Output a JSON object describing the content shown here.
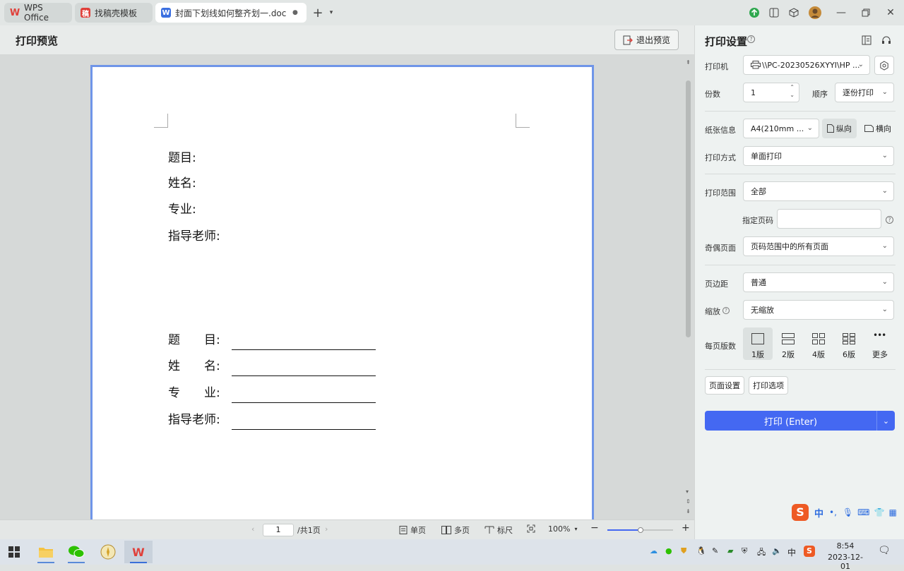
{
  "titlebar": {
    "tabs": [
      {
        "label": "WPS Office",
        "icon": "wps-logo-icon"
      },
      {
        "label": "找稿壳模板",
        "icon": "template-logo-icon"
      },
      {
        "label": "封面下划线如何整齐划一.doc（预",
        "icon": "word-doc-icon"
      }
    ],
    "new_tab": "+",
    "colors": {
      "accent": "#4468f2",
      "wps_red": "#e0403a",
      "word_blue": "#3b6fe0"
    }
  },
  "preview": {
    "title": "打印预览",
    "exit_label": "退出预览"
  },
  "document": {
    "lines_top": [
      "题目:",
      "姓名:",
      "专业:",
      "指导老师:"
    ],
    "lines_bottom": [
      "题　　目:",
      "姓　　名:",
      "专　　业:",
      "指导老师:"
    ]
  },
  "statusbar": {
    "page_value": "1",
    "page_total": "/共1页",
    "single": "单页",
    "multi": "多页",
    "ruler": "标尺",
    "zoom": "100%",
    "zoom_level": 0.5
  },
  "panel": {
    "title": "打印设置",
    "printer_label": "打印机",
    "printer_value": "\\\\PC-20230526XYYI\\HP ...",
    "copies_label": "份数",
    "copies_value": "1",
    "order_label": "顺序",
    "order_value": "逐份打印",
    "paper_label": "纸张信息",
    "paper_value": "A4(210mm ...",
    "portrait": "纵向",
    "landscape": "横向",
    "method_label": "打印方式",
    "method_value": "单面打印",
    "range_label": "打印范围",
    "range_value": "全部",
    "pages_label": "指定页码",
    "pages_value": "",
    "oddeven_label": "奇偶页面",
    "oddeven_value": "页码范围中的所有页面",
    "margin_label": "页边距",
    "margin_value": "普通",
    "scale_label": "缩放",
    "scale_value": "无缩放",
    "perpage_label": "每页版数",
    "perpage_options": [
      "1版",
      "2版",
      "4版",
      "6版",
      "更多"
    ],
    "page_setup": "页面设置",
    "print_options": "打印选项",
    "print_button": "打印 (Enter)"
  },
  "ime": {
    "lang": "中"
  },
  "taskbar": {
    "time": "8:54",
    "date": "2023-12-01",
    "lang": "中"
  }
}
